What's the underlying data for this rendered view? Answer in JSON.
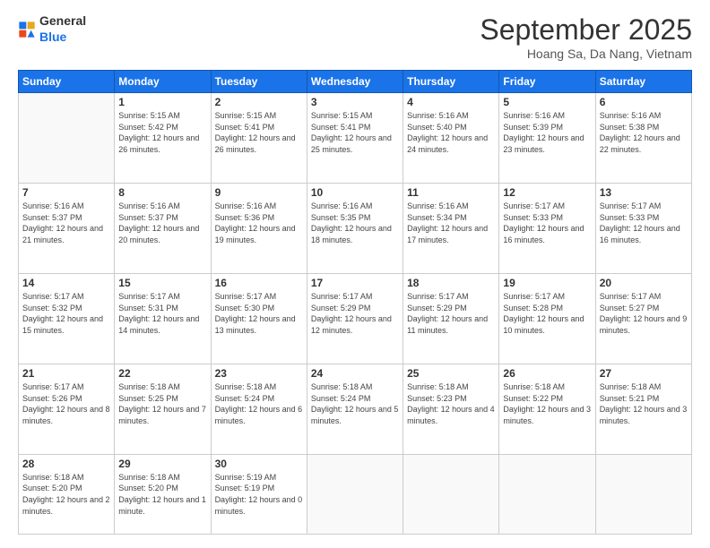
{
  "header": {
    "logo_general": "General",
    "logo_blue": "Blue",
    "month_title": "September 2025",
    "location": "Hoang Sa, Da Nang, Vietnam"
  },
  "days_of_week": [
    "Sunday",
    "Monday",
    "Tuesday",
    "Wednesday",
    "Thursday",
    "Friday",
    "Saturday"
  ],
  "weeks": [
    [
      {
        "num": "",
        "sunrise": "",
        "sunset": "",
        "daylight": ""
      },
      {
        "num": "1",
        "sunrise": "5:15 AM",
        "sunset": "5:42 PM",
        "daylight": "12 hours and 26 minutes."
      },
      {
        "num": "2",
        "sunrise": "5:15 AM",
        "sunset": "5:41 PM",
        "daylight": "12 hours and 26 minutes."
      },
      {
        "num": "3",
        "sunrise": "5:15 AM",
        "sunset": "5:41 PM",
        "daylight": "12 hours and 25 minutes."
      },
      {
        "num": "4",
        "sunrise": "5:16 AM",
        "sunset": "5:40 PM",
        "daylight": "12 hours and 24 minutes."
      },
      {
        "num": "5",
        "sunrise": "5:16 AM",
        "sunset": "5:39 PM",
        "daylight": "12 hours and 23 minutes."
      },
      {
        "num": "6",
        "sunrise": "5:16 AM",
        "sunset": "5:38 PM",
        "daylight": "12 hours and 22 minutes."
      }
    ],
    [
      {
        "num": "7",
        "sunrise": "5:16 AM",
        "sunset": "5:37 PM",
        "daylight": "12 hours and 21 minutes."
      },
      {
        "num": "8",
        "sunrise": "5:16 AM",
        "sunset": "5:37 PM",
        "daylight": "12 hours and 20 minutes."
      },
      {
        "num": "9",
        "sunrise": "5:16 AM",
        "sunset": "5:36 PM",
        "daylight": "12 hours and 19 minutes."
      },
      {
        "num": "10",
        "sunrise": "5:16 AM",
        "sunset": "5:35 PM",
        "daylight": "12 hours and 18 minutes."
      },
      {
        "num": "11",
        "sunrise": "5:16 AM",
        "sunset": "5:34 PM",
        "daylight": "12 hours and 17 minutes."
      },
      {
        "num": "12",
        "sunrise": "5:17 AM",
        "sunset": "5:33 PM",
        "daylight": "12 hours and 16 minutes."
      },
      {
        "num": "13",
        "sunrise": "5:17 AM",
        "sunset": "5:33 PM",
        "daylight": "12 hours and 16 minutes."
      }
    ],
    [
      {
        "num": "14",
        "sunrise": "5:17 AM",
        "sunset": "5:32 PM",
        "daylight": "12 hours and 15 minutes."
      },
      {
        "num": "15",
        "sunrise": "5:17 AM",
        "sunset": "5:31 PM",
        "daylight": "12 hours and 14 minutes."
      },
      {
        "num": "16",
        "sunrise": "5:17 AM",
        "sunset": "5:30 PM",
        "daylight": "12 hours and 13 minutes."
      },
      {
        "num": "17",
        "sunrise": "5:17 AM",
        "sunset": "5:29 PM",
        "daylight": "12 hours and 12 minutes."
      },
      {
        "num": "18",
        "sunrise": "5:17 AM",
        "sunset": "5:29 PM",
        "daylight": "12 hours and 11 minutes."
      },
      {
        "num": "19",
        "sunrise": "5:17 AM",
        "sunset": "5:28 PM",
        "daylight": "12 hours and 10 minutes."
      },
      {
        "num": "20",
        "sunrise": "5:17 AM",
        "sunset": "5:27 PM",
        "daylight": "12 hours and 9 minutes."
      }
    ],
    [
      {
        "num": "21",
        "sunrise": "5:17 AM",
        "sunset": "5:26 PM",
        "daylight": "12 hours and 8 minutes."
      },
      {
        "num": "22",
        "sunrise": "5:18 AM",
        "sunset": "5:25 PM",
        "daylight": "12 hours and 7 minutes."
      },
      {
        "num": "23",
        "sunrise": "5:18 AM",
        "sunset": "5:24 PM",
        "daylight": "12 hours and 6 minutes."
      },
      {
        "num": "24",
        "sunrise": "5:18 AM",
        "sunset": "5:24 PM",
        "daylight": "12 hours and 5 minutes."
      },
      {
        "num": "25",
        "sunrise": "5:18 AM",
        "sunset": "5:23 PM",
        "daylight": "12 hours and 4 minutes."
      },
      {
        "num": "26",
        "sunrise": "5:18 AM",
        "sunset": "5:22 PM",
        "daylight": "12 hours and 3 minutes."
      },
      {
        "num": "27",
        "sunrise": "5:18 AM",
        "sunset": "5:21 PM",
        "daylight": "12 hours and 3 minutes."
      }
    ],
    [
      {
        "num": "28",
        "sunrise": "5:18 AM",
        "sunset": "5:20 PM",
        "daylight": "12 hours and 2 minutes."
      },
      {
        "num": "29",
        "sunrise": "5:18 AM",
        "sunset": "5:20 PM",
        "daylight": "12 hours and 1 minute."
      },
      {
        "num": "30",
        "sunrise": "5:19 AM",
        "sunset": "5:19 PM",
        "daylight": "12 hours and 0 minutes."
      },
      {
        "num": "",
        "sunrise": "",
        "sunset": "",
        "daylight": ""
      },
      {
        "num": "",
        "sunrise": "",
        "sunset": "",
        "daylight": ""
      },
      {
        "num": "",
        "sunrise": "",
        "sunset": "",
        "daylight": ""
      },
      {
        "num": "",
        "sunrise": "",
        "sunset": "",
        "daylight": ""
      }
    ]
  ]
}
